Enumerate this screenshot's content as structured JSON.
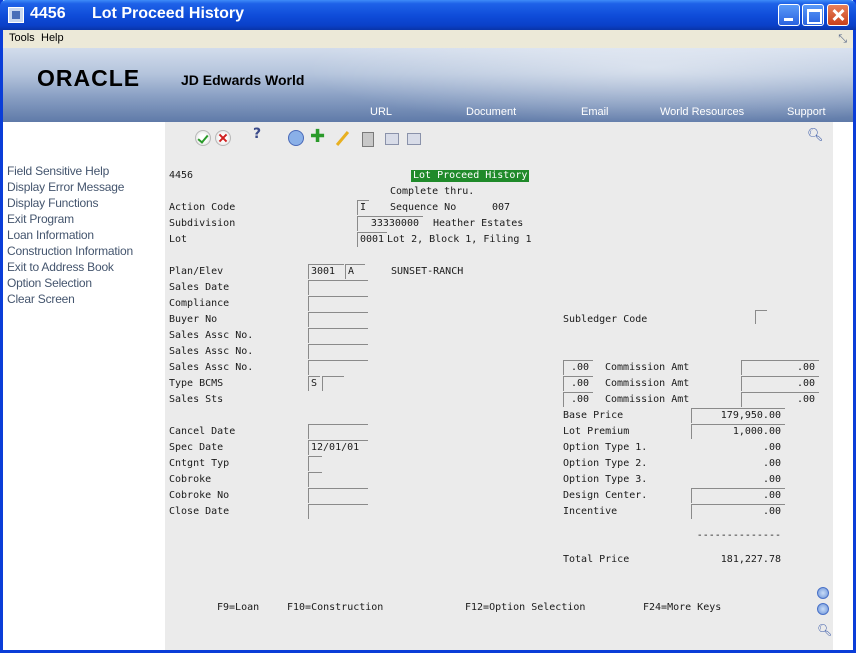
{
  "window": {
    "number": "4456",
    "title": "Lot Proceed History"
  },
  "menu": {
    "tools": "Tools",
    "help": "Help"
  },
  "banner": {
    "logo_brand": "ORACLE",
    "logo_product": "JD Edwards World",
    "links": [
      "URL",
      "Document",
      "Email",
      "World Resources",
      "Support"
    ]
  },
  "sidebar": {
    "items": [
      "Field Sensitive Help",
      "Display Error Message",
      "Display Functions",
      "Exit Program",
      "Loan Information",
      "Construction Information",
      "Exit to Address Book",
      "Option Selection",
      "Clear Screen"
    ]
  },
  "toolbar": {
    "help_glyph": "?"
  },
  "form": {
    "program_id": "4456",
    "screen_title": "Lot Proceed History",
    "complete_thru": "Complete thru.",
    "action_code_label": "Action Code",
    "action_code_value": "I",
    "sequence_label": "Sequence No",
    "sequence_value": "007",
    "subdivision_label": "Subdivision",
    "subdivision_value": "33330000",
    "subdivision_name": "Heather Estates",
    "lot_label": "Lot",
    "lot_value": "0001",
    "lot_desc": "Lot 2, Block 1, Filing 1",
    "plan_label": "Plan/Elev",
    "plan_value": "3001",
    "elev_value": "A",
    "plan_name": "SUNSET-RANCH",
    "sales_date_label": "Sales Date",
    "subledger_label": "Subledger Code",
    "compliance_label": "Compliance",
    "buyer_label": "Buyer No",
    "sales_assoc_label": "Sales Assc No.",
    "commission_pct": [
      ".00",
      ".00",
      ".00"
    ],
    "commission_label": "Commission Amt",
    "commission_amt": [
      ".00",
      ".00",
      ".00"
    ],
    "type_bcms_label": "Type BCMS",
    "type_bcms_value": "S",
    "base_price_label": "Base Price",
    "base_price_value": "179,950.00",
    "sales_sts_label": "Sales Sts",
    "lot_premium_label": "Lot Premium",
    "lot_premium_value": "1,000.00",
    "option_type_1_label": "Option Type 1.",
    "option_type_1_value": ".00",
    "cancel_date_label": "Cancel Date",
    "option_type_2_label": "Option Type 2.",
    "option_type_2_value": ".00",
    "spec_date_label": "Spec Date",
    "spec_date_value": "12/01/01",
    "option_type_3_label": "Option Type 3.",
    "option_type_3_value": ".00",
    "cntgnt_label": "Cntgnt Typ",
    "design_center_label": "Design Center.",
    "design_center_value": ".00",
    "cobroke_label": "Cobroke",
    "incentive_label": "Incentive",
    "incentive_value": ".00",
    "cobroke_no_label": "Cobroke No",
    "total_rule": "--------------",
    "close_date_label": "Close Date",
    "total_price_label": "Total Price",
    "total_price_value": "181,227.78"
  },
  "function_keys": [
    "F9=Loan",
    "F10=Construction",
    "F12=Option Selection",
    "F24=More Keys"
  ]
}
